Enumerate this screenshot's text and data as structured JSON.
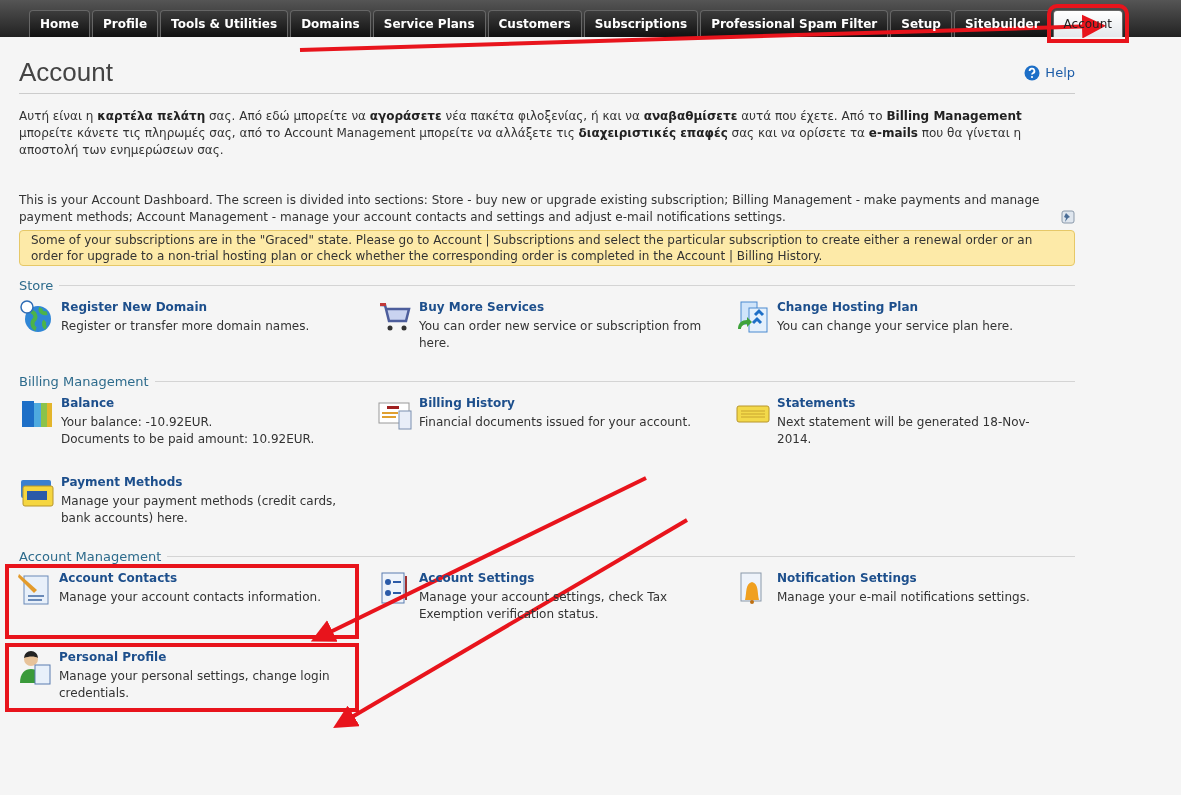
{
  "tabs": [
    {
      "label": "Home",
      "selected": false,
      "highlighted": false
    },
    {
      "label": "Profile",
      "selected": false,
      "highlighted": false
    },
    {
      "label": "Tools & Utilities",
      "selected": false,
      "highlighted": false
    },
    {
      "label": "Domains",
      "selected": false,
      "highlighted": false
    },
    {
      "label": "Service Plans",
      "selected": false,
      "highlighted": false
    },
    {
      "label": "Customers",
      "selected": false,
      "highlighted": false
    },
    {
      "label": "Subscriptions",
      "selected": false,
      "highlighted": false
    },
    {
      "label": "Professional Spam Filter",
      "selected": false,
      "highlighted": false
    },
    {
      "label": "Setup",
      "selected": false,
      "highlighted": false
    },
    {
      "label": "Sitebuilder",
      "selected": false,
      "highlighted": false
    },
    {
      "label": "Account",
      "selected": true,
      "highlighted": true
    }
  ],
  "page": {
    "title": "Account",
    "help": "Help"
  },
  "intro_greek": "Αυτή είναι η **καρτέλα πελάτη** σας. Από εδώ μπορείτε να **αγοράσετε** νέα πακέτα φιλοξενίας, ή και να **αναβαθμίσετε** αυτά που έχετε. Από το **Billing Management** μπορείτε κάνετε τις πληρωμές σας, από το Account Management μπορείτε να αλλάξετε τις **διαχειριστικές επαφές** σας και να ορίσετε τα **e-mails** που θα γίνεται η αποστολή των ενημερώσεων σας.",
  "intro_english": "This is your Account Dashboard. The screen is divided into sections: Store - buy new or upgrade existing subscription; Billing Management - make payments and manage payment methods; Account Management - manage your account contacts and settings and adjust e-mail notifications settings.",
  "warning": "Some of your subscriptions are in the \"Graced\" state. Please go to Account | Subscriptions and select the particular subscription to create either a renewal order or an order for upgrade to a non-trial hosting plan or check whether the corresponding order is completed in the Account | Billing History.",
  "sections": [
    {
      "title": "Store",
      "items": [
        {
          "kind": "globe",
          "title": "Register New Domain",
          "description": "Register or transfer more domain names.",
          "highlighted": false
        },
        {
          "kind": "cart",
          "title": "Buy More Services",
          "description": "You can order new service or subscription from here.",
          "highlighted": false
        },
        {
          "kind": "plan",
          "title": "Change Hosting Plan",
          "description": "You can change your service plan here.",
          "highlighted": false
        }
      ]
    },
    {
      "title": "Billing Management",
      "items": [
        {
          "kind": "binders",
          "title": "Balance",
          "description": "Your balance: -10.92EUR.\nDocuments to be paid amount: 10.92EUR.",
          "highlighted": false
        },
        {
          "kind": "invoice",
          "title": "Billing History",
          "description": "Financial documents issued for your account.",
          "highlighted": false
        },
        {
          "kind": "card",
          "title": "Statements",
          "description": "Next statement will be generated 18-Nov-2014.",
          "highlighted": false
        },
        {
          "kind": "visa",
          "title": "Payment Methods",
          "description": "Manage your payment methods (credit cards, bank accounts) here.",
          "highlighted": false
        }
      ]
    },
    {
      "title": "Account Management",
      "items": [
        {
          "kind": "contacts",
          "title": "Account Contacts",
          "description": "Manage your account contacts information.",
          "highlighted": true
        },
        {
          "kind": "settings",
          "title": "Account Settings",
          "description": "Manage your account settings, check Tax Exemption verification status.",
          "highlighted": false
        },
        {
          "kind": "bell",
          "title": "Notification Settings",
          "description": "Manage your e-mail notifications settings.",
          "highlighted": false
        },
        {
          "kind": "person",
          "title": "Personal Profile",
          "description": "Manage your personal settings, change login credentials.",
          "highlighted": true
        }
      ]
    }
  ]
}
